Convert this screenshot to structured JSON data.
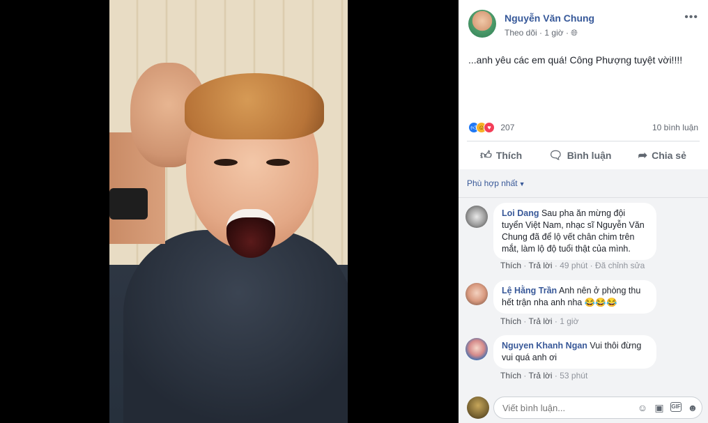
{
  "post": {
    "author": "Nguyễn Văn Chung",
    "follow": "Theo dõi",
    "time": "1 giờ",
    "text": "...anh yêu các em quá! Công Phượng tuyệt vời!!!!",
    "reaction_count": "207",
    "comment_count": "10 bình luận",
    "more_icon": "•••"
  },
  "actions": {
    "like": "Thích",
    "comment": "Bình luận",
    "share": "Chia sẻ"
  },
  "comments_section": {
    "sort_label": "Phù hợp nhất",
    "comments": [
      {
        "author": "Loi Dang",
        "text": "Sau pha ăn mừng đội tuyển Việt Nam, nhạc sĩ Nguyễn Văn Chung đã để lộ vết chân chim trên mắt, làm lộ độ tuổi thật của mình.",
        "like": "Thích",
        "reply": "Trả lời",
        "time": "49 phút",
        "edited": "Đã chỉnh sửa"
      },
      {
        "author": "Lệ Hằng Trần",
        "text": "Anh nên ở phòng thu hết trận nha anh nha 😂😂😂",
        "like": "Thích",
        "reply": "Trả lời",
        "time": "1 giờ"
      },
      {
        "author": "Nguyen Khanh Ngan",
        "text": "Vui thôi đừng vui quá anh ơi",
        "like": "Thích",
        "reply": "Trả lời",
        "time": "53 phút"
      }
    ],
    "compose_placeholder": "Viết bình luận..."
  },
  "colors": {
    "link": "#385898",
    "author": "#365899",
    "panel_bg": "#ffffff",
    "comments_bg": "#f2f3f5"
  }
}
